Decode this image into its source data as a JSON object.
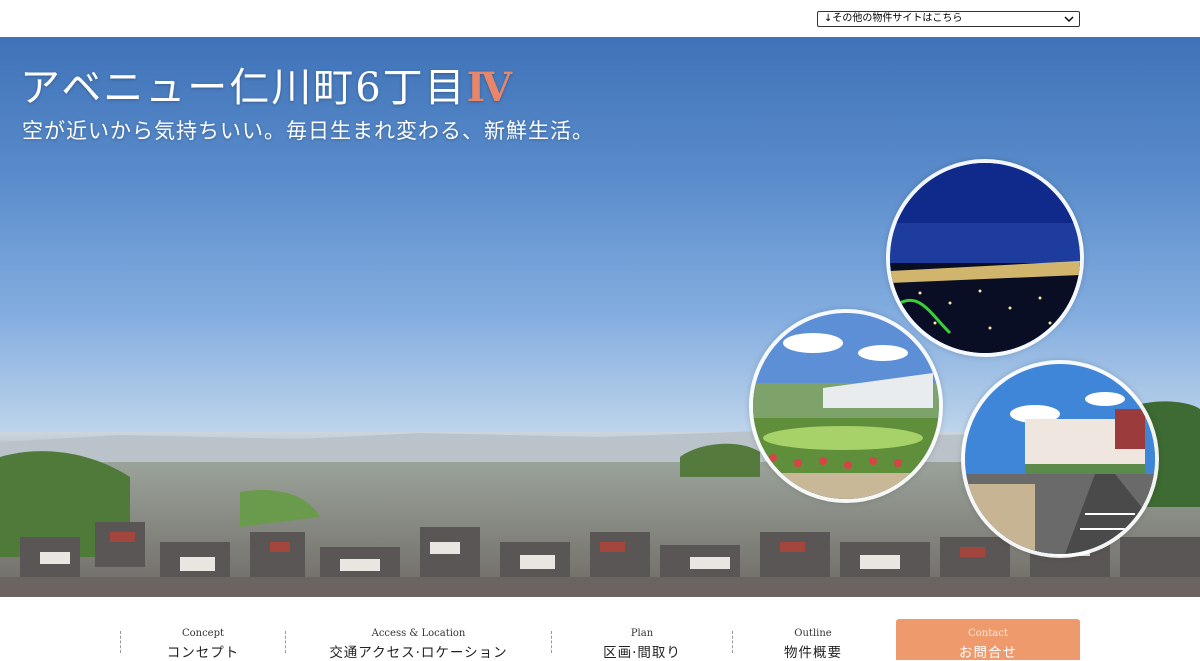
{
  "site_select": {
    "value": "↓その他の物件サイトはこちら"
  },
  "hero": {
    "title_main": "アベニュー仁川町6丁目",
    "title_number": "Ⅳ",
    "subtitle": "空が近いから気持ちいい。毎日生まれ変わる、新鮮生活。"
  },
  "nav": {
    "items": [
      {
        "en": "Concept",
        "ja": "コンセプト"
      },
      {
        "en": "Access & Location",
        "ja": "交通アクセス·ロケーション"
      },
      {
        "en": "Plan",
        "ja": "区画·間取り"
      },
      {
        "en": "Outline",
        "ja": "物件概要"
      }
    ],
    "contact": {
      "en": "Contact",
      "ja": "お問合せ"
    }
  },
  "colors": {
    "accent": "#ef9a6c",
    "title_number": "#e8866a",
    "sky_top": "#3f73b8"
  },
  "icons": [
    "chevron-down-icon"
  ]
}
